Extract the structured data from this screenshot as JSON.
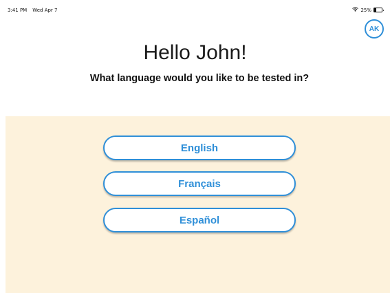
{
  "status_bar": {
    "time": "3:41 PM",
    "date": "Wed Apr 7",
    "battery_text": "25%",
    "battery_level": 0.25,
    "icons": [
      "wifi-icon",
      "battery-icon"
    ]
  },
  "avatar": {
    "initials": "AK"
  },
  "header": {
    "greeting": "Hello John!",
    "question": "What language would you like to be tested in?"
  },
  "languages": [
    {
      "label": "English"
    },
    {
      "label": "Français"
    },
    {
      "label": "Español"
    }
  ],
  "colors": {
    "accent": "#2f8fd8",
    "panel_background": "#fdf2dc",
    "button_background": "#ffffff"
  }
}
